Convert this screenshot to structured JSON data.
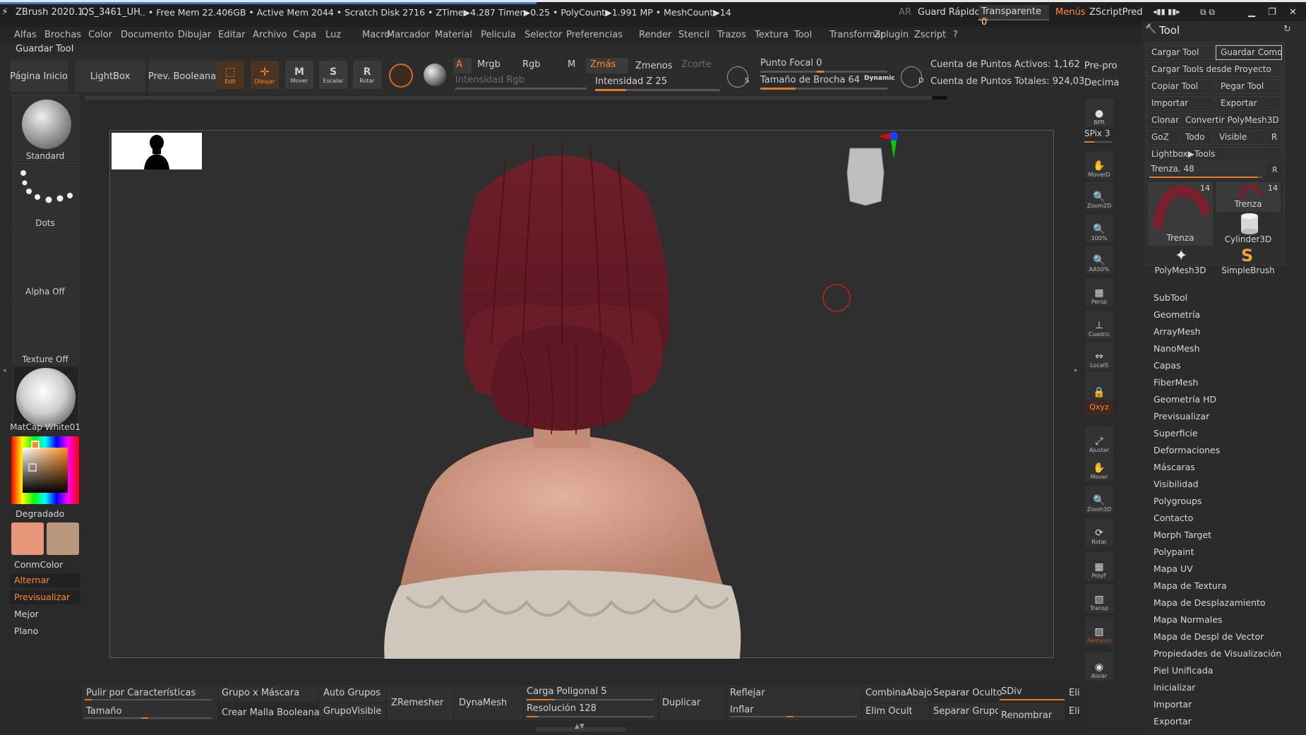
{
  "title_bar": {
    "app": "ZBrush 2020.1",
    "file": "QS_3461_UH",
    "stats": ".. • Free Mem 22.406GB • Active Mem 2044 • Scratch Disk 2716 • ZTime▶4.287 Timer▶0.25 • PolyCount▶1.991 MP • MeshCount▶14",
    "ar": "AR",
    "guard_rapido": "Guard Rápido",
    "transparente": "Transparente 0",
    "menus": "Menús",
    "zscriptpred": "ZScriptPred"
  },
  "menu": [
    "Alfas",
    "Brochas",
    "Color",
    "Documento",
    "Dibujar",
    "Editar",
    "Archivo",
    "Capa",
    "Luz",
    "Macro",
    "Marcador",
    "Material",
    "Pelicula",
    "Selector",
    "Preferencias",
    "Render",
    "Stencil",
    "Trazos",
    "Textura",
    "Tool",
    "Transformar",
    "Zplugin",
    "Zscript",
    "?"
  ],
  "guardar_tool": "Guardar Tool",
  "top": {
    "pagina_inicio": "Página Inicio",
    "lightbox": "LightBox",
    "prev_booleana": "Prev. Booleana",
    "edit": "Edit",
    "dibujar": "Dibujar",
    "mover": "Mover",
    "escalar": "Escalar",
    "rotar": "Rotar",
    "a": "A",
    "mrgb": "Mrgb",
    "rgb": "Rgb",
    "m": "M",
    "zmas": "Zmás",
    "zmenos": "Zmenos",
    "zcorte": "Zcorte",
    "intensidad_rgb": "Intensidad Rgb",
    "intensidad_z": "Intensidad Z 25",
    "intensidad_z_value": 25,
    "punto_focal": "Punto Focal 0",
    "tamano_brocha": "Tamaño de Brocha 64",
    "dynamic": "Dynamic",
    "puntos_activos": "Cuenta de Puntos Activos: 1,162",
    "puntos_totales": "Cuenta de Puntos Totales: 924,03",
    "pre_pro": "Pre-pro",
    "decima": "Decima"
  },
  "left": {
    "standard": "Standard",
    "dots": "Dots",
    "alpha_off": "Alpha Off",
    "texture_off": "Texture Off",
    "matcap": "MatCap White01",
    "degradado": "Degradado",
    "conmcolor": "ConmColor",
    "alternar": "Alternar",
    "previsualizar": "Previsualizar",
    "mejor": "Mejor",
    "plano": "Plano",
    "main_color": "#e8967a",
    "secondary_color": "#b8977a"
  },
  "right_strip": [
    {
      "name": "bpr-button",
      "label": "BPR"
    },
    {
      "name": "spix-control",
      "label": "SPix 3"
    },
    {
      "name": "moverd-button",
      "label": "MoverD"
    },
    {
      "name": "zoom2d-button",
      "label": "Zoom2D"
    },
    {
      "name": "zoom100-button",
      "label": "100%"
    },
    {
      "name": "aa50-button",
      "label": "AA50%"
    },
    {
      "name": "persp-button",
      "label": "Persp"
    },
    {
      "name": "cuadric-button",
      "label": "Cuadric"
    },
    {
      "name": "locals-button",
      "label": "LocalS"
    },
    {
      "name": "lock-button",
      "label": ""
    },
    {
      "name": "xyz-button",
      "label": "Qxyz"
    },
    {
      "name": "ajustar-button",
      "label": "Ajustar"
    },
    {
      "name": "mover-button",
      "label": "Mover"
    },
    {
      "name": "zoom3d-button",
      "label": "Zoom3D"
    },
    {
      "name": "rotar-button",
      "label": "Rotar"
    },
    {
      "name": "polyf-button",
      "label": "PolyF"
    },
    {
      "name": "transp-button",
      "label": "Transp"
    },
    {
      "name": "fantasm-button",
      "label": "Fantasm"
    },
    {
      "name": "aislar-button",
      "label": "Aislar"
    }
  ],
  "tool_panel": {
    "title": "Tool",
    "cargar_tool": "Cargar Tool",
    "guardar_como": "Guardar Como",
    "cargar_desde_proyecto": "Cargar Tools desde Proyecto",
    "copiar_tool": "Copiar Tool",
    "pegar_tool": "Pegar Tool",
    "importar": "Importar",
    "exportar": "Exportar",
    "clonar": "Clonar",
    "convertir": "Convertir PolyMesh3D",
    "goz": "GoZ",
    "todo": "Todo",
    "visible": "Visible",
    "r": "R",
    "lightbox_tools": "Lightbox▶Tools",
    "trenza_slider": "Trenza. 48",
    "thumbs": [
      {
        "label": "Trenza",
        "count": "14"
      },
      {
        "label": "Trenza",
        "count": "14"
      },
      {
        "label": "Cylinder3D",
        "count": ""
      },
      {
        "label": "PolyMesh3D",
        "count": ""
      },
      {
        "label": "SimpleBrush",
        "count": ""
      }
    ],
    "items": [
      "SubTool",
      "Geometría",
      "ArrayMesh",
      "NanoMesh",
      "Capas",
      "FiberMesh",
      "Geometría HD",
      "Previsualizar",
      "Superficie",
      "Deformaciones",
      "Máscaras",
      "Visibilidad",
      "Polygroups",
      "Contacto",
      "Morph Target",
      "Polypaint",
      "Mapa UV",
      "Mapa de Textura",
      "Mapa de Desplazamiento",
      "Mapa Normales",
      "Mapa de Despl de Vector",
      "Propiedades de Visualización",
      "Piel Unificada",
      "Inicializar",
      "Importar",
      "Exportar"
    ]
  },
  "bottom": {
    "pulir": "Pulir por Características",
    "tamano": "Tamaño",
    "grupo_mascara": "Grupo x Máscara",
    "crear_malla": "Crear Malla Booleana",
    "auto_grupos": "Auto Grupos",
    "grupovisible": "GrupoVisible",
    "zremesher": "ZRemesher",
    "dynamesh": "DynaMesh",
    "carga_poligonal": "Carga Poligonal 5",
    "resolucion": "Resolución 128",
    "duplicar": "Duplicar",
    "reflejar": "Reflejar",
    "inflar": "Inflar",
    "combinaabajo": "CombinaAbajo",
    "elim_ocult": "Elim Ocult",
    "separar_oculto": "Separar Oculto",
    "separar_grupo": "Separar Grupo",
    "sdiv": "SDiv",
    "renombrar": "Renombrar",
    "eli1": "Eli",
    "eli2": "Eli"
  }
}
